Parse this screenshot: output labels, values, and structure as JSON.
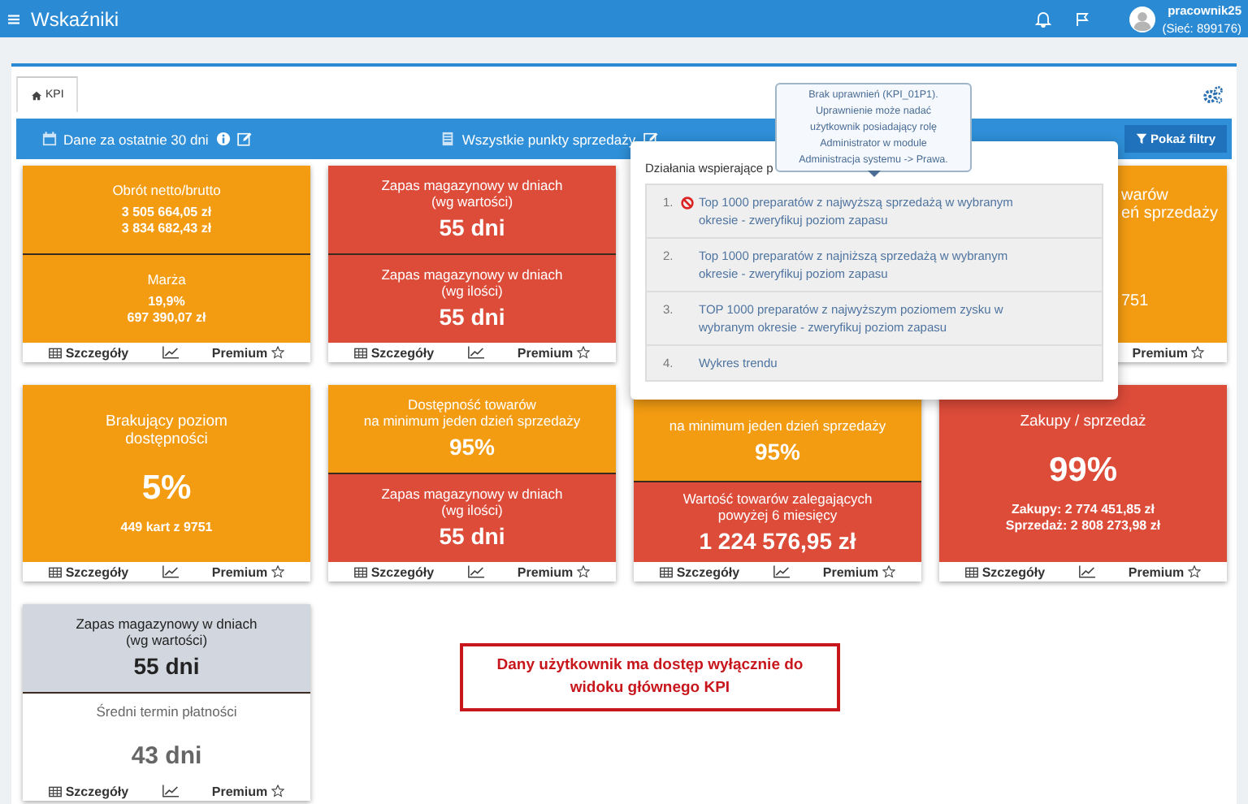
{
  "header": {
    "title": "Wskaźniki",
    "user": "pracownik25",
    "network": "(Sieć: 899176)"
  },
  "tabs": [
    {
      "label": "KPI",
      "selected": true
    }
  ],
  "filter_bar": {
    "period": "Dane za ostatnie 30 dni",
    "points": "Wszystkie punkty sprzedaży",
    "button": "Pokaż filtry"
  },
  "card_rows": [
    [
      {
        "kind": "full",
        "segments": [
          {
            "color": "#f39c12",
            "title": [
              "Obrót netto/brutto"
            ],
            "details": [
              "3 505 664,05 zł",
              "3 834 682,43 zł"
            ]
          },
          {
            "color": "#f39c12",
            "title": [
              "Marża"
            ],
            "details": [
              "19,9%",
              "697 390,07 zł"
            ]
          }
        ],
        "footer": [
          {
            "kind": "details",
            "label": "Szczegóły"
          },
          {
            "kind": "chart"
          },
          {
            "kind": "premium",
            "label": "Premium"
          }
        ]
      },
      {
        "kind": "full",
        "segments": [
          {
            "color": "#dd4b39",
            "title": [
              "Zapas magazynowy w dniach",
              "(wg wartości)"
            ],
            "value": "55 dni"
          },
          {
            "color": "#dd4b39",
            "title": [
              "Zapas magazynowy w dniach",
              "(wg ilości)"
            ],
            "value": "55 dni"
          }
        ],
        "footer": [
          {
            "kind": "details",
            "label": "Szczegóły"
          },
          {
            "kind": "chart"
          },
          {
            "kind": "premium",
            "label": "Premium"
          }
        ]
      },
      {
        "kind": "partial",
        "segments": [
          {
            "color": "#f39c12",
            "title": [
              "warów",
              "eń sprzedaży"
            ],
            "details": [
              "751"
            ]
          }
        ],
        "footer": [
          {
            "kind": "premium",
            "label": "Premium"
          }
        ]
      }
    ],
    [
      {
        "kind": "full",
        "segments": [
          {
            "color": "#f39c12",
            "title": [
              "Brakujący poziom",
              "dostępności"
            ],
            "value": "5%",
            "details": [
              "449 kart z 9751"
            ]
          }
        ],
        "footer": [
          {
            "kind": "details",
            "label": "Szczegóły"
          },
          {
            "kind": "chart"
          },
          {
            "kind": "premium",
            "label": "Premium"
          }
        ]
      },
      {
        "kind": "full",
        "segments": [
          {
            "color": "#f39c12",
            "title": [
              "Dostępność towarów",
              "na minimum jeden dzień sprzedaży"
            ],
            "value": "95%"
          },
          {
            "color": "#dd4b39",
            "title": [
              "Zapas magazynowy w dniach",
              "(wg ilości)"
            ],
            "value": "55 dni"
          }
        ],
        "footer": [
          {
            "kind": "details",
            "label": "Szczegóły"
          },
          {
            "kind": "chart"
          },
          {
            "kind": "premium",
            "label": "Premium"
          }
        ]
      },
      {
        "kind": "covered",
        "segments": [
          {
            "color": "#f39c12",
            "title": [
              "na minimum jeden dzień sprzedaży"
            ],
            "value": "95%"
          },
          {
            "color": "#dd4b39",
            "title": [
              "Wartość towarów zalegających",
              "powyżej 6 miesięcy"
            ],
            "value": "1 224 576,95 zł"
          }
        ],
        "footer": [
          {
            "kind": "details",
            "label": "Szczegóły"
          },
          {
            "kind": "chart"
          },
          {
            "kind": "premium",
            "label": "Premium"
          }
        ]
      },
      {
        "kind": "full",
        "segments": [
          {
            "color": "#dd4b39",
            "title": [
              "Zakupy / sprzedaż"
            ],
            "value": "99%",
            "details": [
              "Zakupy: 2 774 451,85 zł",
              "Sprzedaż: 2 808 273,98 zł"
            ]
          }
        ],
        "footer": [
          {
            "kind": "details",
            "label": "Szczegóły"
          },
          {
            "kind": "chart"
          },
          {
            "kind": "premium",
            "label": "Premium"
          }
        ]
      }
    ],
    [
      {
        "kind": "full",
        "segments": [
          {
            "color": "#d2d6de",
            "title": [
              "Zapas magazynowy w dniach",
              "(wg wartości)"
            ],
            "value": "55 dni"
          },
          {
            "color": "#ffffff",
            "title": [
              "Średni termin płatności"
            ],
            "value": "43 dni"
          }
        ],
        "footer": [
          {
            "kind": "details",
            "label": "Szczegóły"
          },
          {
            "kind": "chart"
          },
          {
            "kind": "premium",
            "label": "Premium"
          }
        ]
      }
    ]
  ],
  "note": [
    "Dany użytkownik ma dostęp wyłącznie do",
    "widoku głównego KPI"
  ],
  "actions_popup": {
    "header": "Działania wspierające p",
    "items": [
      {
        "number": "1.",
        "text": "Top 1000 preparatów z najwyższą sprzedażą w wybranym okresie - zweryfikuj poziom zapasu"
      },
      {
        "number": "2.",
        "text": "Top 1000 preparatów z najniższą sprzedażą w wybranym okresie - zweryfikuj poziom zapasu"
      },
      {
        "number": "3.",
        "text": "TOP 1000 preparatów z najwyższym poziomem zysku w wybranym okresie - zweryfikuj poziom zapasu"
      },
      {
        "number": "4.",
        "text": "Wykres trendu"
      }
    ]
  },
  "tooltip": [
    "Brak uprawnień (KPI_01P1).",
    "Uprawnienie może nadać",
    "użytkownik posiadający rolę",
    "Administrator w module",
    "Administracja systemu -> Prawa."
  ]
}
